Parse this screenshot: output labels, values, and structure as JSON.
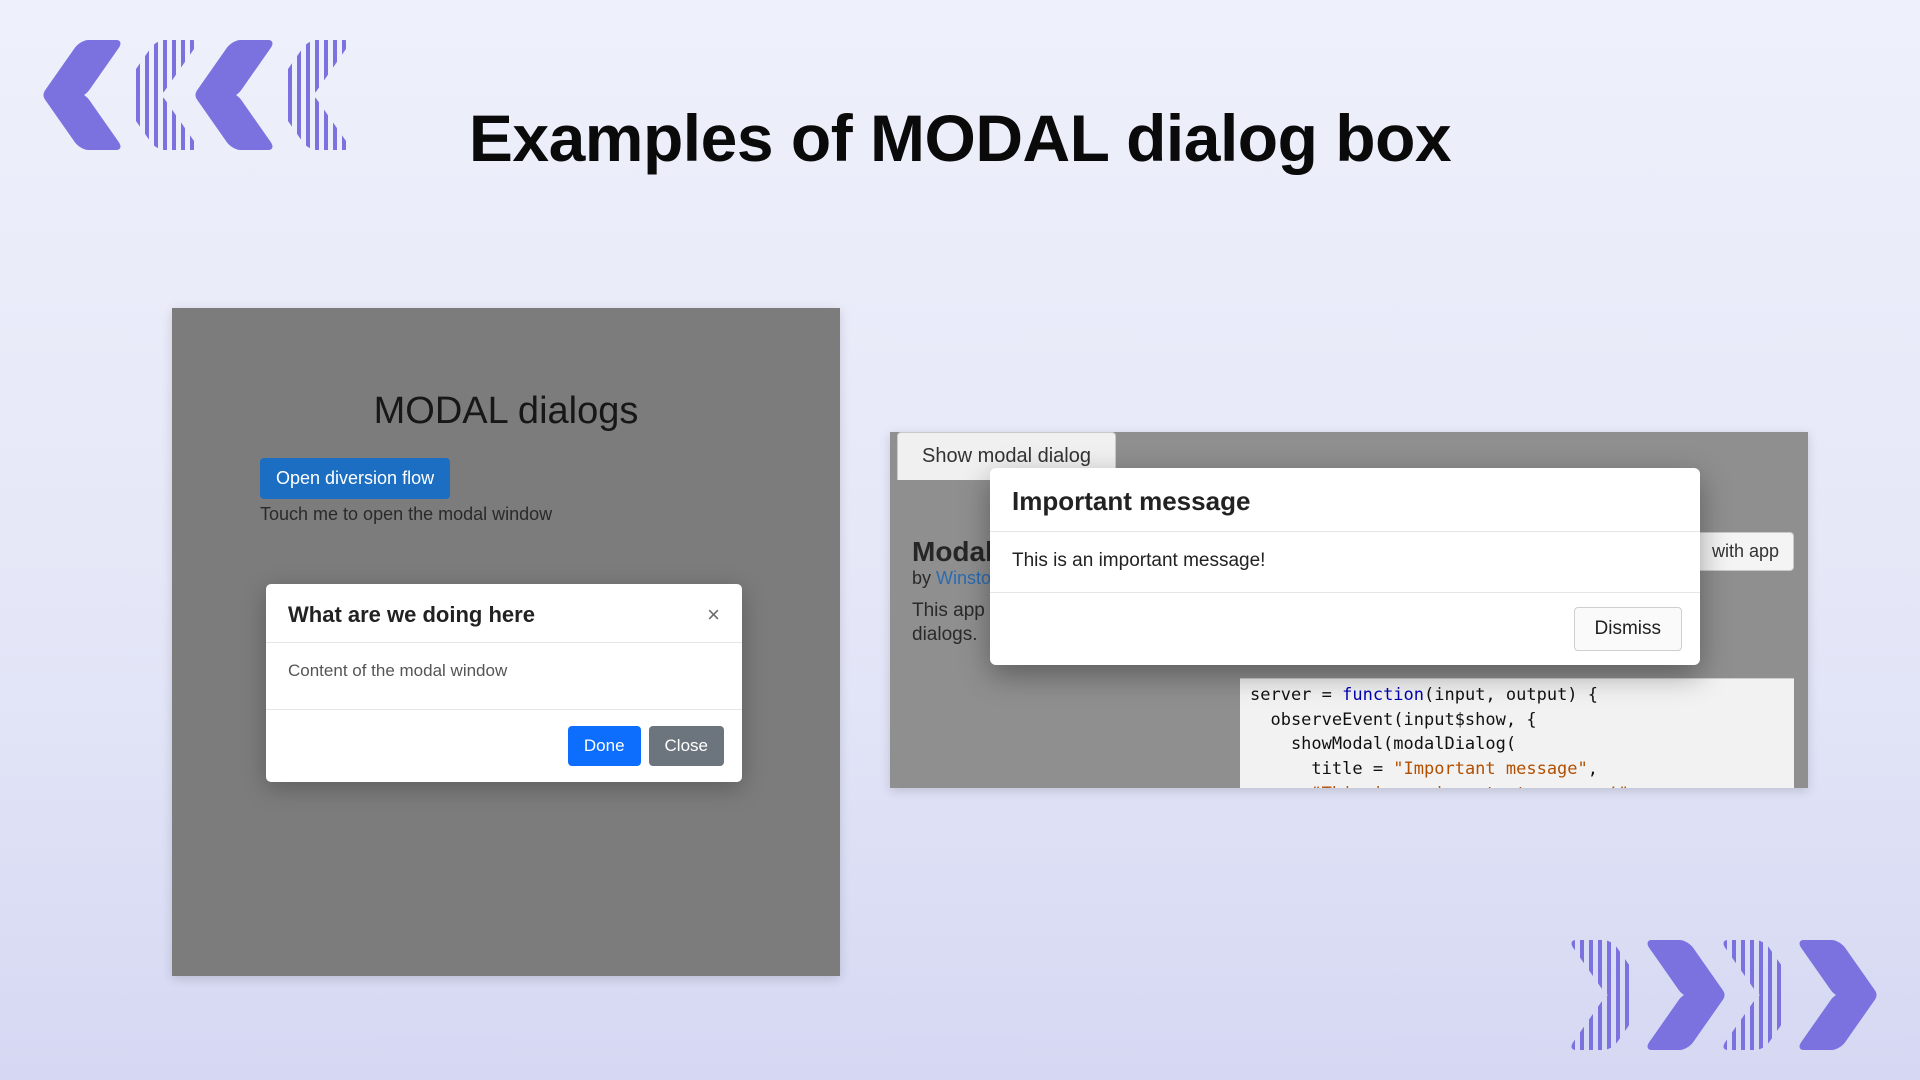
{
  "slide": {
    "title": "Examples of MODAL dialog box"
  },
  "example1": {
    "page_heading": "MODAL dialogs",
    "open_button": "Open diversion flow",
    "open_hint": "Touch me to open the modal window",
    "modal": {
      "title": "What are we doing here",
      "body": "Content of the modal window",
      "done": "Done",
      "close": "Close"
    }
  },
  "example2": {
    "tab": "Show modal dialog",
    "with_app": "with app",
    "bg_title_partial": "Modal d",
    "by_prefix": "by ",
    "by_author_partial": "Winston",
    "desc_line1_partial": "This app d",
    "desc_line2_partial": "dialogs.",
    "modal": {
      "title": "Important message",
      "body": "This is an important message!",
      "dismiss": "Dismiss"
    },
    "code": {
      "l1a": "server = ",
      "l1b": "function",
      "l1c": "(input, output) {",
      "l2": "  observeEvent(input$show, {",
      "l3": "    showModal(modalDialog(",
      "l4a": "      title = ",
      "l4b": "\"Important message\"",
      "l4c": ",",
      "l5a": "      ",
      "l5b": "\"This is an important message!\"",
      "l5c": ","
    }
  }
}
